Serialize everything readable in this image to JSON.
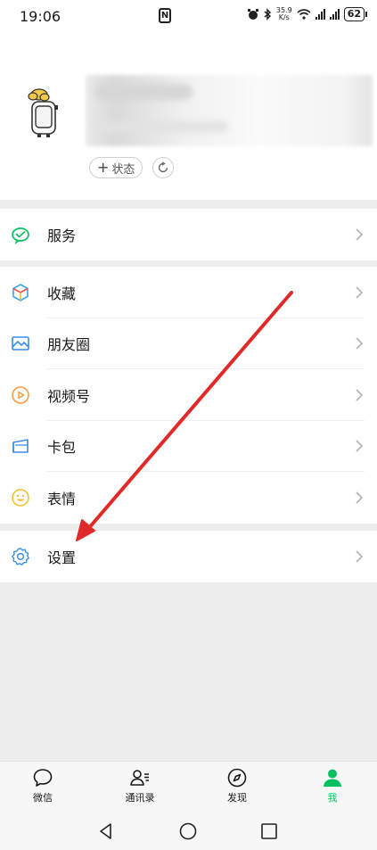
{
  "status_bar": {
    "time": "19:06",
    "network_speed_value": "35.9",
    "network_speed_unit": "K/s",
    "battery": "62"
  },
  "profile": {
    "status_button_label": "状态"
  },
  "menu": {
    "services": {
      "label": "服务",
      "icon": "wechat-pay-icon"
    },
    "favorites": {
      "label": "收藏",
      "icon": "favorites-cube-icon"
    },
    "moments": {
      "label": "朋友圈",
      "icon": "moments-image-icon"
    },
    "channels": {
      "label": "视频号",
      "icon": "channels-play-icon"
    },
    "cards": {
      "label": "卡包",
      "icon": "card-wallet-icon"
    },
    "stickers": {
      "label": "表情",
      "icon": "smiley-icon"
    },
    "settings": {
      "label": "设置",
      "icon": "gear-icon"
    }
  },
  "tabbar": {
    "chats": "微信",
    "contacts": "通讯录",
    "discover": "发现",
    "me": "我"
  },
  "colors": {
    "accent_green": "#07c160",
    "annotation_arrow": "#e02a2a",
    "page_background": "#ededed"
  }
}
